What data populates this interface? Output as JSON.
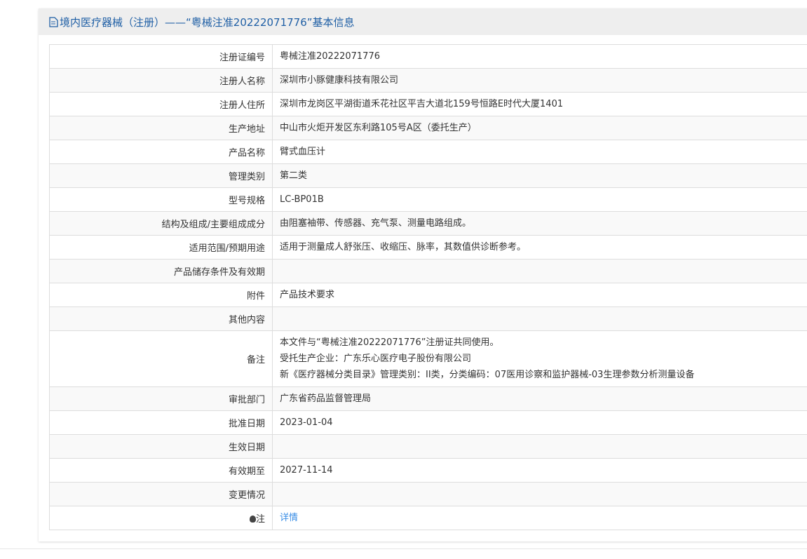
{
  "header": {
    "title": "境内医疗器械（注册）——“粤械注准20222071776”基本信息",
    "icon": "document-icon"
  },
  "rows": [
    {
      "label": "注册证编号",
      "value": "粤械注准20222071776"
    },
    {
      "label": "注册人名称",
      "value": "深圳市小豚健康科技有限公司"
    },
    {
      "label": "注册人住所",
      "value": "深圳市龙岗区平湖街道禾花社区平吉大道北159号恒路E时代大厦1401"
    },
    {
      "label": "生产地址",
      "value": "中山市火炬开发区东利路105号A区（委托生产）"
    },
    {
      "label": "产品名称",
      "value": "臂式血压计"
    },
    {
      "label": "管理类别",
      "value": "第二类"
    },
    {
      "label": "型号规格",
      "value": "LC-BP01B"
    },
    {
      "label": "结构及组成/主要组成成分",
      "value": "由阻塞袖带、传感器、充气泵、测量电路组成。"
    },
    {
      "label": "适用范围/预期用途",
      "value": "适用于测量成人舒张压、收缩压、脉率，其数值供诊断参考。"
    },
    {
      "label": "产品储存条件及有效期",
      "value": ""
    },
    {
      "label": "附件",
      "value": "产品技术要求"
    },
    {
      "label": "其他内容",
      "value": ""
    }
  ],
  "remarks": {
    "label": "备注",
    "lines": [
      "本文件与“粤械注准20222071776”注册证共同使用。",
      "受托生产企业：广东乐心医疗电子股份有限公司",
      "新《医疗器械分类目录》管理类别：II类，分类编码：07医用诊察和监护器械-03生理参数分析测量设备"
    ]
  },
  "rows2": [
    {
      "label": "审批部门",
      "value": "广东省药品监督管理局"
    },
    {
      "label": "批准日期",
      "value": "2023-01-04"
    },
    {
      "label": "生效日期",
      "value": ""
    },
    {
      "label": "有效期至",
      "value": "2027-11-14"
    },
    {
      "label": "变更情况",
      "value": ""
    }
  ],
  "note": {
    "label": "注",
    "icon": "lightbulb-icon",
    "link": "详情"
  }
}
